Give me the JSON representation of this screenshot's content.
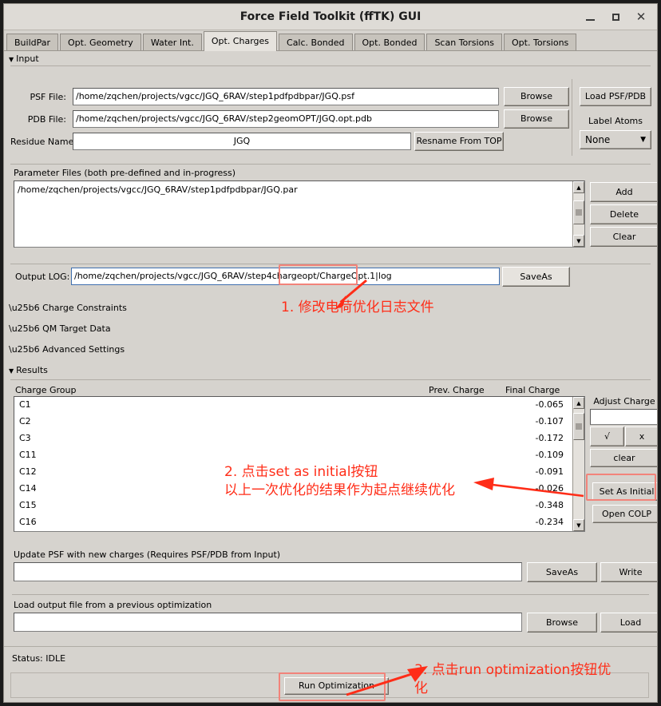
{
  "window": {
    "title": "Force Field Toolkit (ffTK) GUI",
    "buttons": {
      "minimize": "minimize-button",
      "maximize": "maximize-button",
      "close": "close-button"
    }
  },
  "tabs": [
    {
      "label": "BuildPar",
      "active": false
    },
    {
      "label": "Opt. Geometry",
      "active": false
    },
    {
      "label": "Water Int.",
      "active": false
    },
    {
      "label": "Opt. Charges",
      "active": true
    },
    {
      "label": "Calc. Bonded",
      "active": false
    },
    {
      "label": "Opt. Bonded",
      "active": false
    },
    {
      "label": "Scan Torsions",
      "active": false
    },
    {
      "label": "Opt. Torsions",
      "active": false
    }
  ],
  "input": {
    "section_label": "Input",
    "section_tri": "▼",
    "psf_label": "PSF File:",
    "psf_value": "/home/zqchen/projects/vgcc/JGQ_6RAV/step1pdfpdbpar/JGQ.psf",
    "psf_browse": "Browse",
    "pdb_label": "PDB File:",
    "pdb_value": "/home/zqchen/projects/vgcc/JGQ_6RAV/step2geomOPT/JGQ.opt.pdb",
    "pdb_browse": "Browse",
    "residue_label": "Residue Name:",
    "residue_value": "JGQ",
    "resname_button": "Resname From TOP",
    "load_button": "Load PSF/PDB",
    "label_atoms_label": "Label Atoms",
    "label_atoms_value": "None"
  },
  "parameter_files": {
    "label": "Parameter Files (both pre-defined and in-progress)",
    "items": [
      "/home/zqchen/projects/vgcc/JGQ_6RAV/step1pdfpdbpar/JGQ.par"
    ],
    "add_button": "Add",
    "delete_button": "Delete",
    "clear_button": "Clear"
  },
  "output_log": {
    "label": "Output LOG:",
    "value": "/home/zqchen/projects/vgcc/JGQ_6RAV/step4chargeopt/ChargeOpt.1|log",
    "saveas_button": "SaveAs"
  },
  "collapsed_sections": [
    {
      "label": "\\u25b6 Charge Constraints"
    },
    {
      "label": "\\u25b6 QM Target Data"
    },
    {
      "label": "\\u25b6 Advanced Settings"
    }
  ],
  "results": {
    "section_label": "Results",
    "section_tri": "▼",
    "columns": [
      "Charge Group",
      "Prev. Charge",
      "Final Charge"
    ],
    "rows": [
      {
        "group": "C1",
        "prev": "",
        "final": "-0.065"
      },
      {
        "group": "C2",
        "prev": "",
        "final": "-0.107"
      },
      {
        "group": "C3",
        "prev": "",
        "final": "-0.172"
      },
      {
        "group": "C11",
        "prev": "",
        "final": "-0.109"
      },
      {
        "group": "C12",
        "prev": "",
        "final": "-0.091"
      },
      {
        "group": "C14",
        "prev": "",
        "final": "-0.026"
      },
      {
        "group": "C15",
        "prev": "",
        "final": "-0.348"
      },
      {
        "group": "C16",
        "prev": "",
        "final": "-0.234"
      }
    ],
    "adjust_charge_label": "Adjust Charge",
    "adjust_charge_value": "",
    "accept_button": "√",
    "reject_button": "x",
    "clear_button": "clear",
    "set_as_initial_button": "Set As Initial",
    "open_colp_button": "Open COLP"
  },
  "update_psf": {
    "label": "Update PSF with new charges (Requires PSF/PDB from Input)",
    "value": "",
    "saveas_button": "SaveAs",
    "write_button": "Write"
  },
  "load_output": {
    "label": "Load output file from a previous optimization",
    "value": "",
    "browse_button": "Browse",
    "load_button": "Load"
  },
  "footer": {
    "status": "Status: IDLE",
    "run_button": "Run Optimization"
  },
  "annotations": [
    {
      "id": 1,
      "text": "1. 修改电荷优化日志文件"
    },
    {
      "id": 2,
      "text": "2. 点击set as initial按钮\n以上一次优化的结果作为起点继续优化"
    },
    {
      "id": 3,
      "text": "3. 点击run optimization按钮优\n化"
    }
  ],
  "colors": {
    "annotation_red": "#ff2d18",
    "highlight_box": "#f2837a",
    "window_bg": "#d6d3ce",
    "field_bg": "#ffffff"
  }
}
